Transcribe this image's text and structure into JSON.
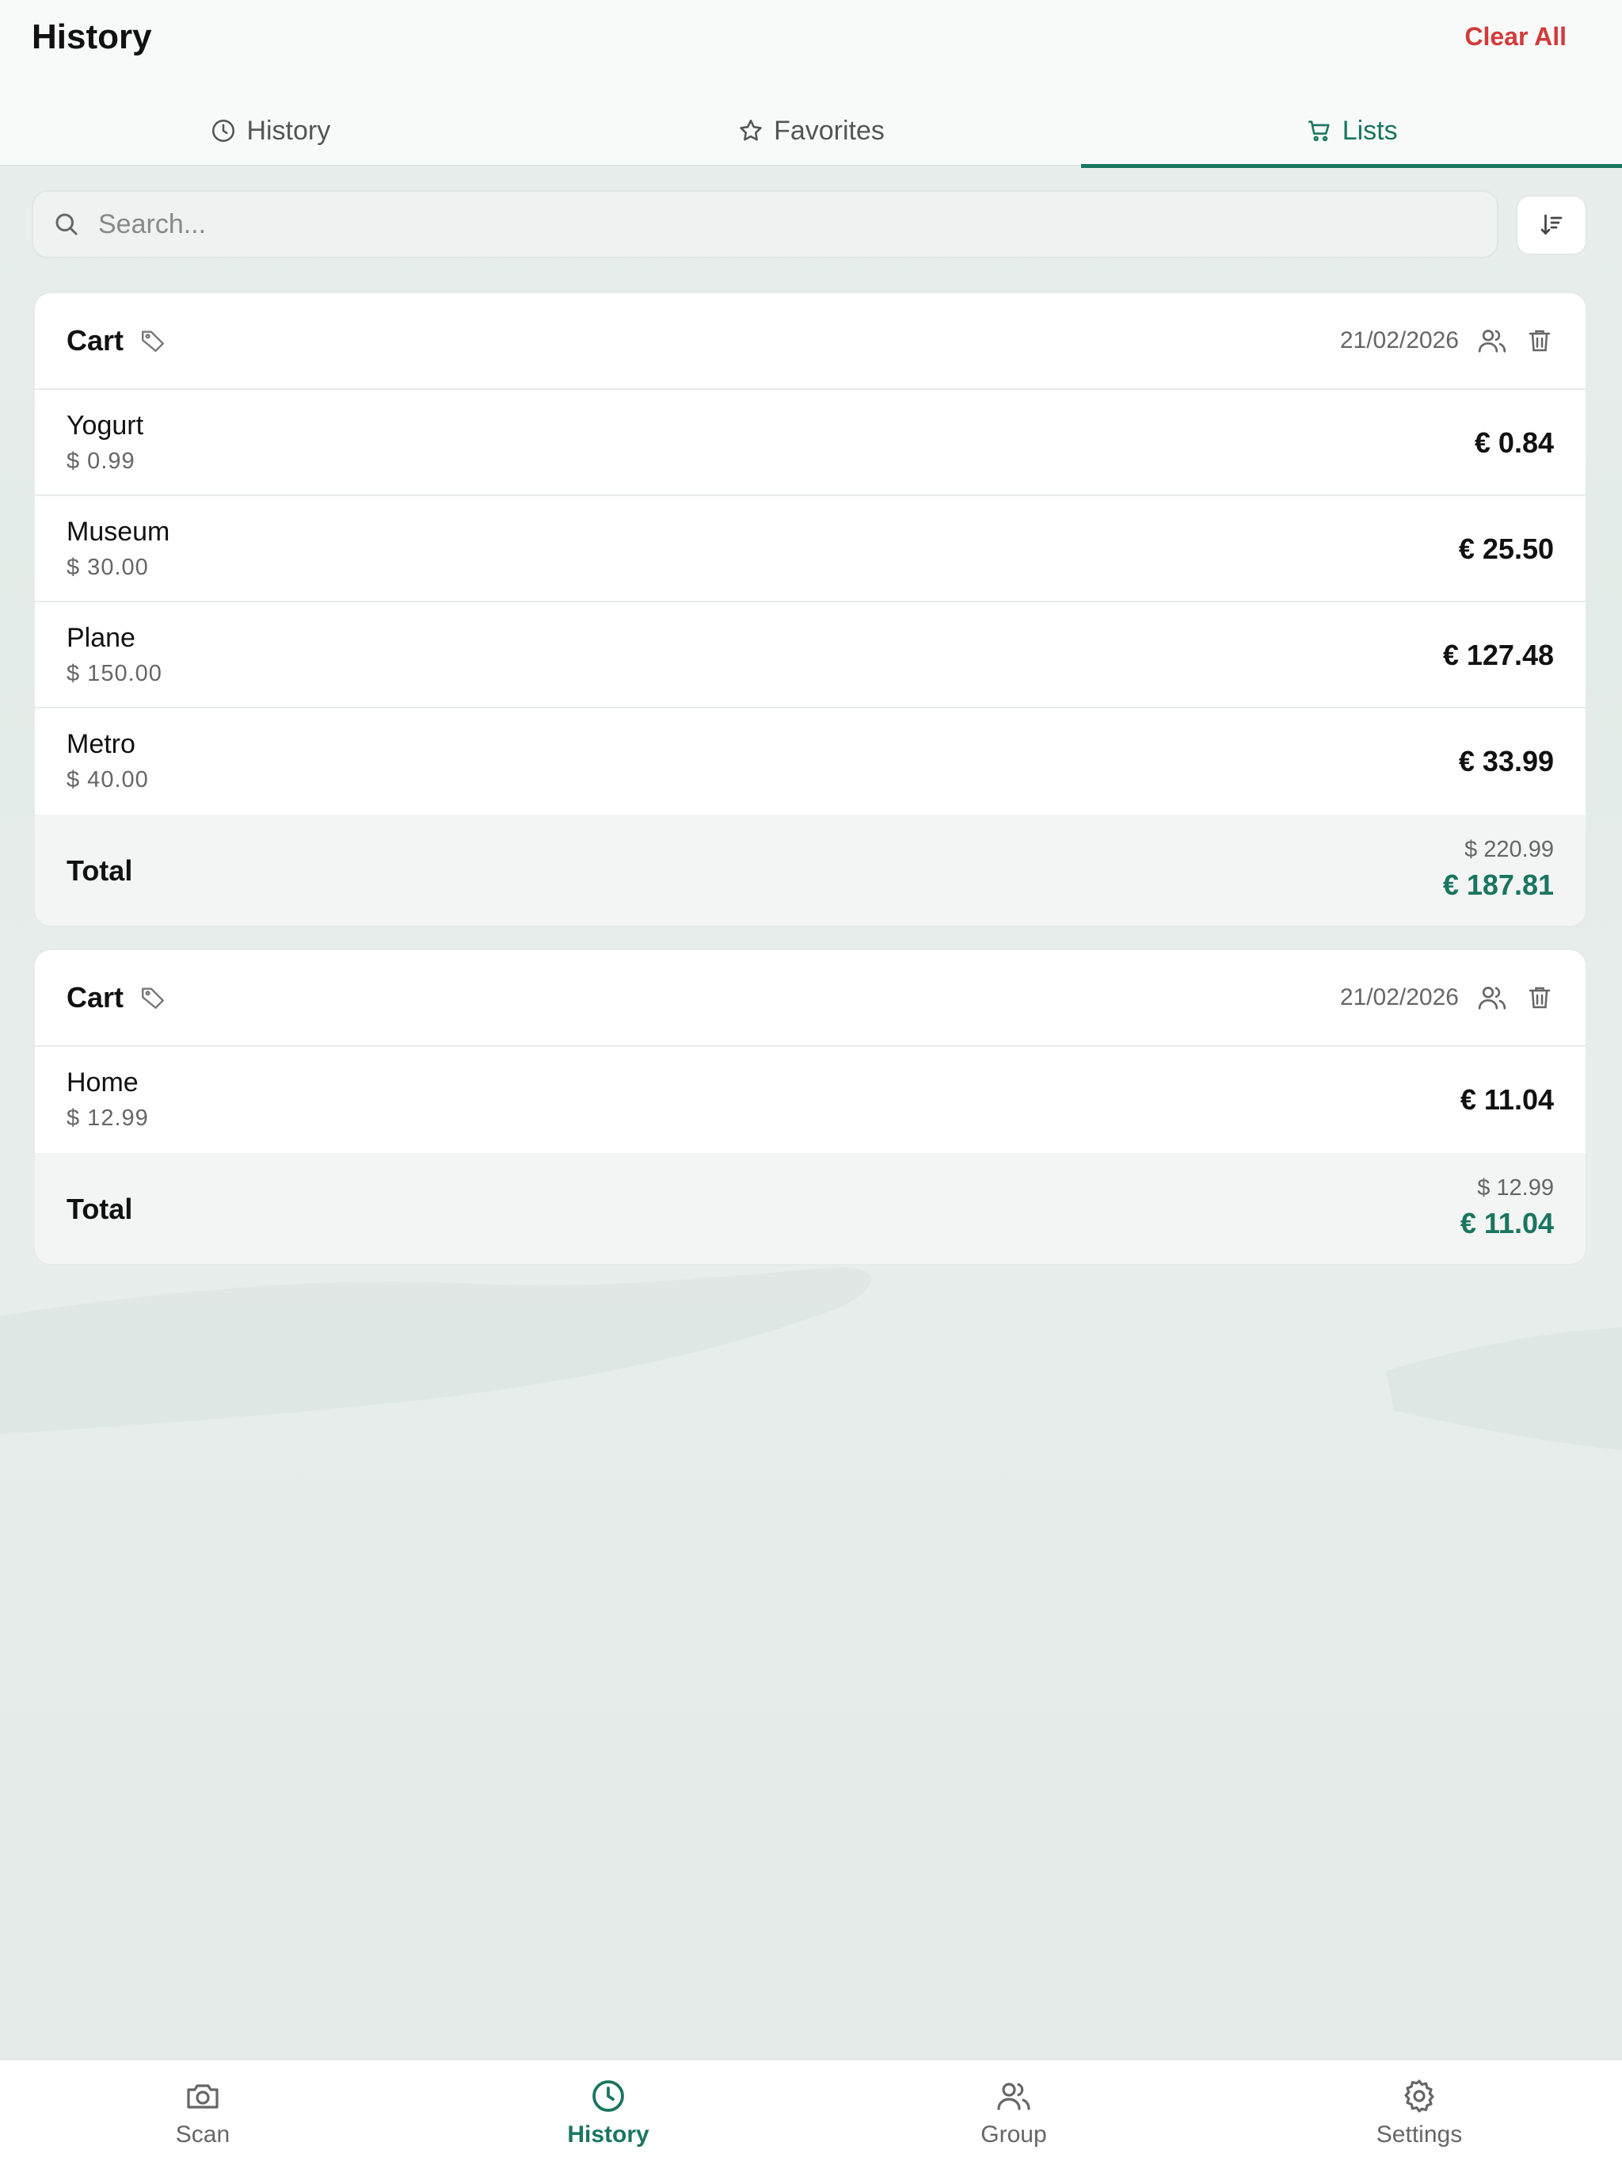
{
  "header": {
    "title": "History",
    "clear_all": "Clear All"
  },
  "tabs": [
    {
      "label": "History",
      "icon": "clock-icon",
      "active": false
    },
    {
      "label": "Favorites",
      "icon": "star-icon",
      "active": false
    },
    {
      "label": "Lists",
      "icon": "cart-icon",
      "active": true
    }
  ],
  "search": {
    "placeholder": "Search...",
    "value": ""
  },
  "accent_color": "#1a7560",
  "danger_color": "#d23a3a",
  "lists": [
    {
      "title": "Cart",
      "date": "21/02/2026",
      "items": [
        {
          "name": "Yogurt",
          "original": "$ 0.99",
          "converted": "€ 0.84"
        },
        {
          "name": "Museum",
          "original": "$ 30.00",
          "converted": "€ 25.50"
        },
        {
          "name": "Plane",
          "original": "$ 150.00",
          "converted": "€ 127.48"
        },
        {
          "name": "Metro",
          "original": "$ 40.00",
          "converted": "€ 33.99"
        }
      ],
      "total_label": "Total",
      "total_original": "$ 220.99",
      "total_converted": "€ 187.81"
    },
    {
      "title": "Cart",
      "date": "21/02/2026",
      "items": [
        {
          "name": "Home",
          "original": "$ 12.99",
          "converted": "€ 11.04"
        }
      ],
      "total_label": "Total",
      "total_original": "$ 12.99",
      "total_converted": "€ 11.04"
    }
  ],
  "bottom_nav": [
    {
      "label": "Scan",
      "icon": "camera-icon",
      "active": false
    },
    {
      "label": "History",
      "icon": "clock-icon",
      "active": true
    },
    {
      "label": "Group",
      "icon": "group-icon",
      "active": false
    },
    {
      "label": "Settings",
      "icon": "gear-icon",
      "active": false
    }
  ]
}
